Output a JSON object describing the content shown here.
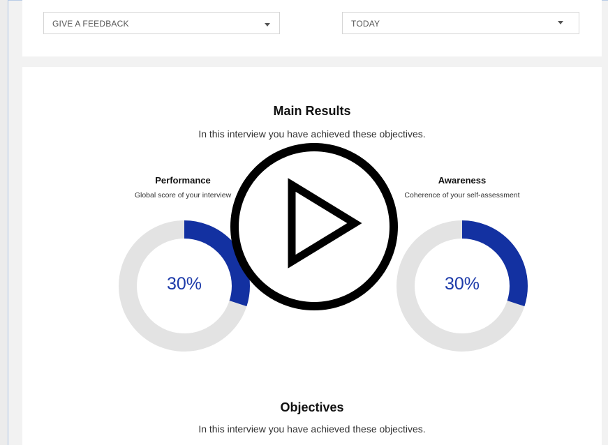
{
  "filters": {
    "feedback_select": "GIVE A FEEDBACK",
    "date_select": "TODAY"
  },
  "main_results": {
    "title": "Main Results",
    "subtitle": "In this interview you have achieved these objectives."
  },
  "metrics": [
    {
      "title": "Performance",
      "subtitle": "Global score of your interview",
      "value": 30,
      "label": "30%"
    },
    {
      "title": "Awareness",
      "subtitle": "Coherence of your self-assessment",
      "value": 30,
      "label": "30%"
    }
  ],
  "objectives": {
    "title": "Objectives",
    "subtitle": "In this interview you have achieved these objectives."
  },
  "colors": {
    "donut_fill": "#1331a1",
    "donut_track": "#e3e3e3",
    "percent_text": "#1c3aa9"
  },
  "icons": {
    "overlay": "play-button-icon",
    "dropdown": "caret-down-icon"
  }
}
